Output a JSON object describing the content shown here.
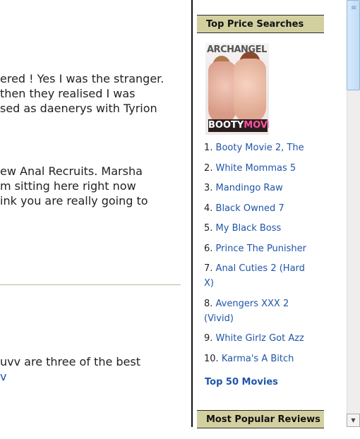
{
  "main": {
    "lines_group1": [
      "ered ! Yes I was the stranger.",
      "then they realised I was",
      "sed as daenerys with Tyrion"
    ],
    "lines_group2": [
      "ew Anal Recruits. Marsha",
      "m sitting here right now",
      "ink you are really going to"
    ],
    "line_group3": "uvv are three of the best",
    "line_group3_link": "v"
  },
  "sidebar": {
    "top_searches_title": "Top Price Searches",
    "cover": {
      "brand": "ARCHANGEL",
      "title_main": "BOOTY",
      "title_tag": "MOVIE!"
    },
    "items": [
      {
        "num": "1.",
        "title": "Booty Movie 2, The"
      },
      {
        "num": "2.",
        "title": "White Mommas 5"
      },
      {
        "num": "3.",
        "title": "Mandingo Raw"
      },
      {
        "num": "4.",
        "title": "Black Owned 7"
      },
      {
        "num": "5.",
        "title": "My Black Boss"
      },
      {
        "num": "6.",
        "title": "Prince The Punisher"
      },
      {
        "num": "7.",
        "title": "Anal Cuties 2 (Hard X)"
      },
      {
        "num": "8.",
        "title": "Avengers XXX 2 (Vivid)"
      },
      {
        "num": "9.",
        "title": "White Girlz Got Azz"
      },
      {
        "num": "10.",
        "title": "Karma's A Bitch"
      }
    ],
    "top50_label": "Top 50 Movies",
    "popular_reviews_title": "Most Popular Reviews"
  },
  "scrollbar": {
    "down_icon": "arrow-down-icon"
  },
  "colors": {
    "header_bg": "#d3d0a0",
    "link": "#1f55a8"
  }
}
